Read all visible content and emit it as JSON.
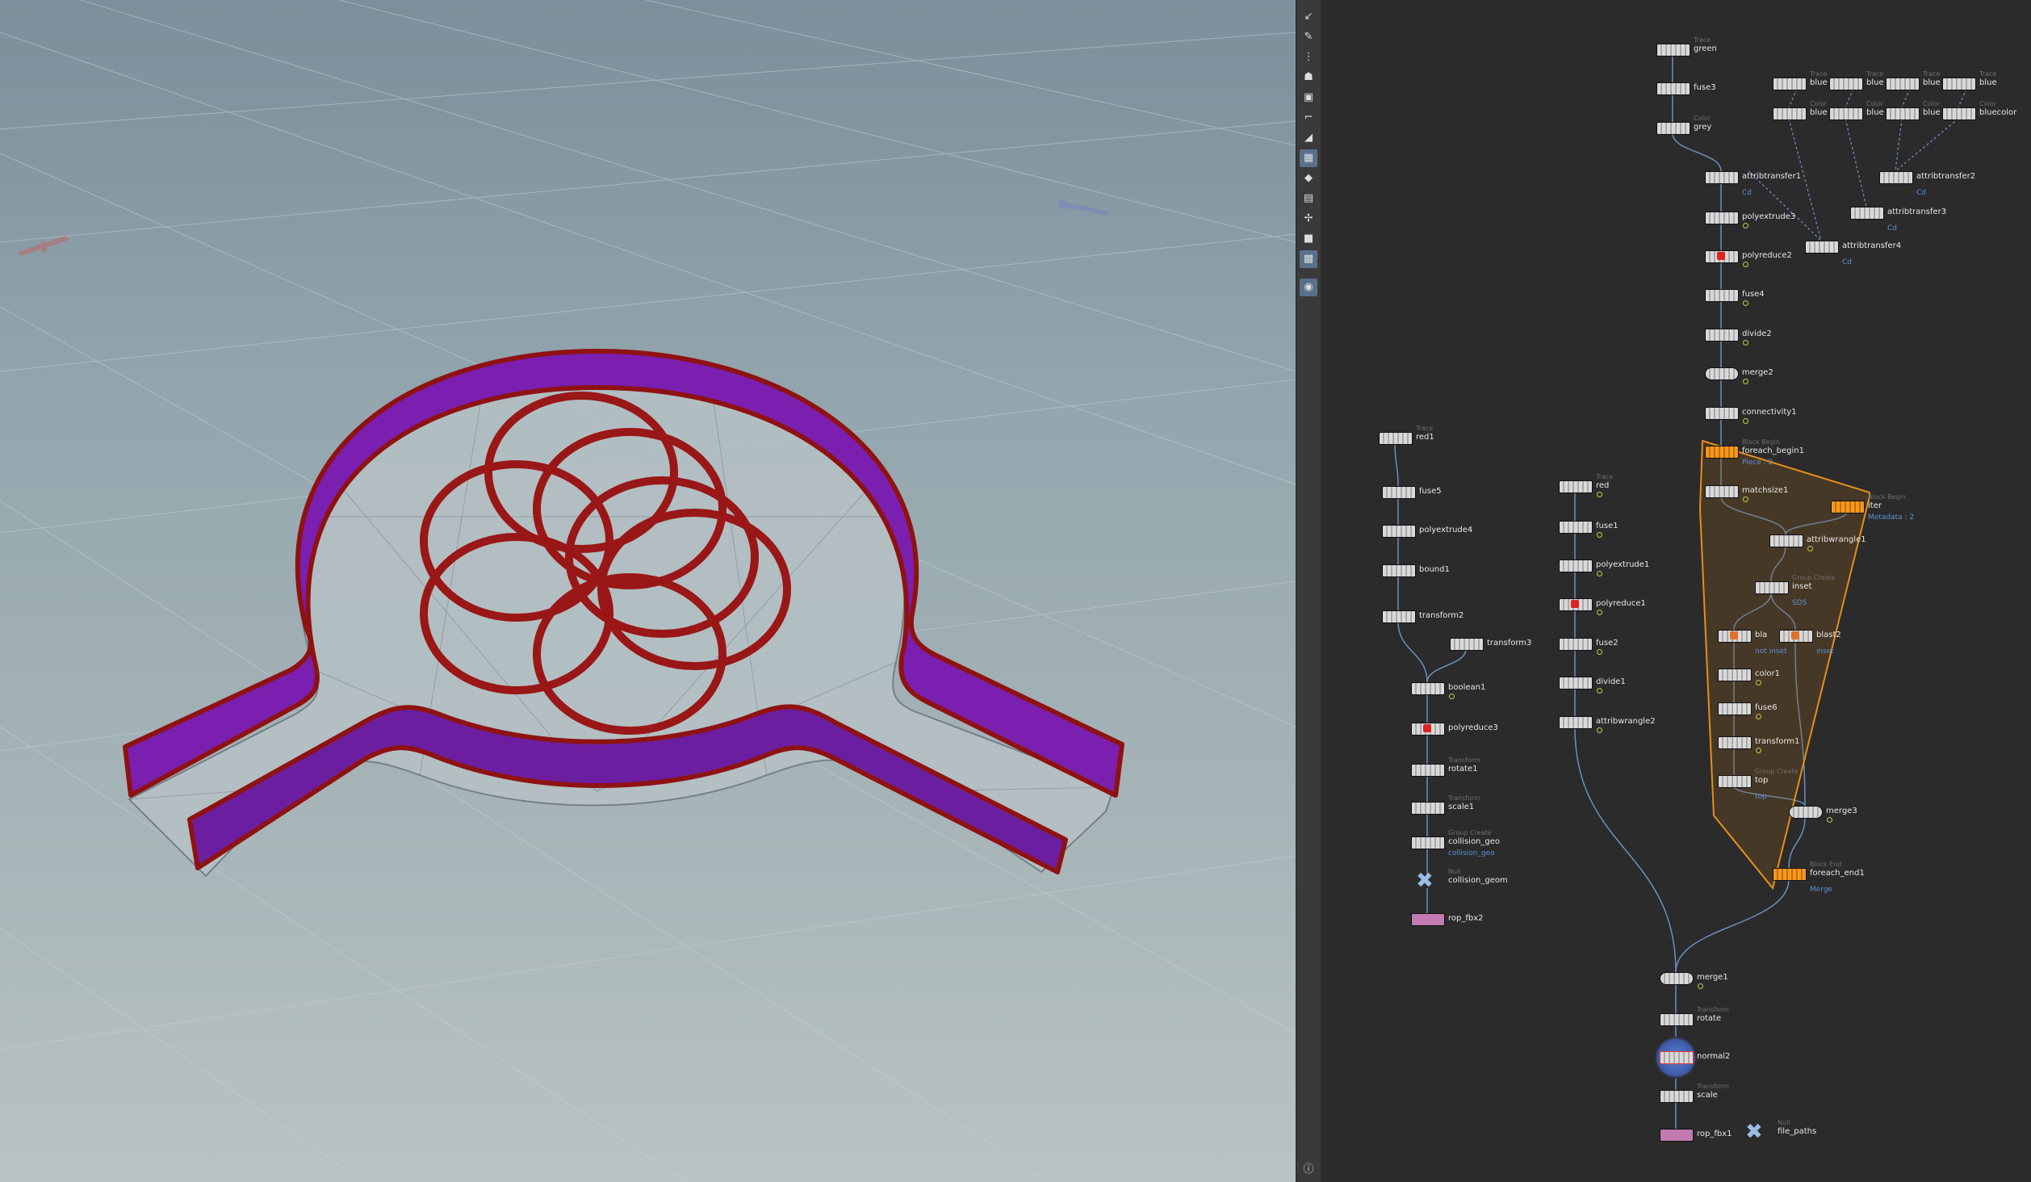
{
  "viewport": {
    "background_top": "#7c8f9a",
    "background_bottom": "#b8c3c3",
    "wall_color": "#6b1fa0",
    "rim_color": "#8e1212",
    "pattern_color": "#9a1717"
  },
  "toolbar": {
    "icons": [
      "select-icon",
      "transform-icon",
      "snap-icon",
      "brush-icon",
      "camera-icon",
      "bone-icon",
      "light-icon",
      "grid-icon",
      "display-icon",
      "shading-icon",
      "wireframe-icon",
      "pivot-icon",
      "frame-icon",
      "ghost-icon",
      "visibility-icon",
      "info-icon"
    ]
  },
  "network": {
    "background": "#2b2b2b",
    "wire_color": "#6a8fbf",
    "nodes": [
      {
        "id": "green",
        "type": "Trace",
        "label": "green"
      },
      {
        "id": "fuse3",
        "type": "",
        "label": "fuse3"
      },
      {
        "id": "grey",
        "type": "Color",
        "label": "grey"
      },
      {
        "id": "blue_a",
        "type": "Trace",
        "label": "blue"
      },
      {
        "id": "blue_b",
        "type": "Trace",
        "label": "blue"
      },
      {
        "id": "blue_c",
        "type": "Trace",
        "label": "blue"
      },
      {
        "id": "blue_d",
        "type": "Trace",
        "label": "blue"
      },
      {
        "id": "bluec_a",
        "type": "Color",
        "label": "blue"
      },
      {
        "id": "bluec_b",
        "type": "Color",
        "label": "blue"
      },
      {
        "id": "bluec_c",
        "type": "Color",
        "label": "blue"
      },
      {
        "id": "bluecolor",
        "type": "Color",
        "label": "bluecolor"
      },
      {
        "id": "attribtransfer1",
        "type": "",
        "label": "attribtransfer1",
        "sub": "Cd"
      },
      {
        "id": "attribtransfer2",
        "type": "",
        "label": "attribtransfer2",
        "sub": "Cd"
      },
      {
        "id": "attribtransfer3",
        "type": "",
        "label": "attribtransfer3",
        "sub": "Cd"
      },
      {
        "id": "attribtransfer4",
        "type": "",
        "label": "attribtransfer4",
        "sub": "Cd"
      },
      {
        "id": "polyextrude3",
        "type": "",
        "label": "polyextrude3"
      },
      {
        "id": "polyreduce2",
        "type": "",
        "label": "polyreduce2"
      },
      {
        "id": "fuse4",
        "type": "",
        "label": "fuse4"
      },
      {
        "id": "divide2",
        "type": "",
        "label": "divide2"
      },
      {
        "id": "merge2",
        "type": "",
        "label": "merge2"
      },
      {
        "id": "connectivity1",
        "type": "",
        "label": "connectivity1"
      },
      {
        "id": "foreach_begin1",
        "type": "Block Begin",
        "label": "foreach_begin1",
        "sub": "Piece : 2"
      },
      {
        "id": "matchsize1",
        "type": "",
        "label": "matchsize1"
      },
      {
        "id": "iter",
        "type": "Block Begin",
        "label": "iter",
        "sub": "Metadata : 2"
      },
      {
        "id": "attribwrangle1",
        "type": "",
        "label": "attribwrangle1"
      },
      {
        "id": "inset",
        "type": "Group Create",
        "label": "inset",
        "sub": "SDS"
      },
      {
        "id": "blast1",
        "type": "",
        "label": "bla",
        "sub": "not inset"
      },
      {
        "id": "blast2",
        "type": "",
        "label": "blast2",
        "sub": "inset"
      },
      {
        "id": "color1",
        "type": "",
        "label": "color1"
      },
      {
        "id": "fuse6",
        "type": "",
        "label": "fuse6"
      },
      {
        "id": "transform1",
        "type": "",
        "label": "transform1"
      },
      {
        "id": "top",
        "type": "Group Create",
        "label": "top",
        "sub": "top"
      },
      {
        "id": "merge3",
        "type": "",
        "label": "merge3"
      },
      {
        "id": "foreach_end1",
        "type": "Block End",
        "label": "foreach_end1",
        "sub": "Merge"
      },
      {
        "id": "red1",
        "type": "Trace",
        "label": "red1"
      },
      {
        "id": "fuse5",
        "type": "",
        "label": "fuse5"
      },
      {
        "id": "polyextrude4",
        "type": "",
        "label": "polyextrude4"
      },
      {
        "id": "bound1",
        "type": "",
        "label": "bound1"
      },
      {
        "id": "transform2",
        "type": "",
        "label": "transform2"
      },
      {
        "id": "transform3",
        "type": "",
        "label": "transform3"
      },
      {
        "id": "boolean1",
        "type": "",
        "label": "boolean1"
      },
      {
        "id": "polyreduce3",
        "type": "",
        "label": "polyreduce3"
      },
      {
        "id": "rotate1",
        "type": "Transform",
        "label": "rotate1"
      },
      {
        "id": "scale1",
        "type": "Transform",
        "label": "scale1"
      },
      {
        "id": "collision_geo",
        "type": "Group Create",
        "label": "collision_geo",
        "sub": "collision_geo"
      },
      {
        "id": "collision_geom",
        "type": "Null",
        "label": "collision_geom"
      },
      {
        "id": "rop_fbx2",
        "type": "",
        "label": "rop_fbx2"
      },
      {
        "id": "red",
        "type": "Trace",
        "label": "red"
      },
      {
        "id": "fuse1",
        "type": "",
        "label": "fuse1"
      },
      {
        "id": "polyextrude1",
        "type": "",
        "label": "polyextrude1"
      },
      {
        "id": "polyreduce1",
        "type": "",
        "label": "polyreduce1"
      },
      {
        "id": "fuse2",
        "type": "",
        "label": "fuse2"
      },
      {
        "id": "divide1",
        "type": "",
        "label": "divide1"
      },
      {
        "id": "attribwrangle2",
        "type": "",
        "label": "attribwrangle2"
      },
      {
        "id": "merge1",
        "type": "",
        "label": "merge1"
      },
      {
        "id": "rotate",
        "type": "Transform",
        "label": "rotate"
      },
      {
        "id": "normal2",
        "type": "",
        "label": "normal2"
      },
      {
        "id": "scale",
        "type": "Transform",
        "label": "scale"
      },
      {
        "id": "rop_fbx1",
        "type": "",
        "label": "rop_fbx1"
      },
      {
        "id": "file_paths",
        "type": "Null",
        "label": "file_paths"
      }
    ]
  }
}
